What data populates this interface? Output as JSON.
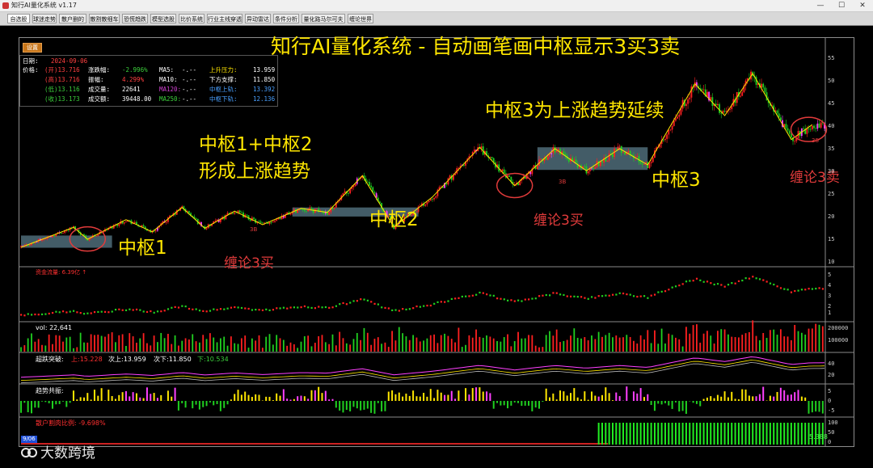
{
  "window": {
    "title": "知行AI量化系统 v1.17",
    "minimize": "—",
    "maximize": "☐",
    "close": "✕"
  },
  "tabs": [
    "自选股",
    "球迷走势",
    "散户删的",
    "散割散细车",
    "恐慌趋跌",
    "模型选股",
    "比价系统",
    "行业主线穿透",
    "异动雷达",
    "条件分析",
    "量化路马尔可夫",
    "缠论世界"
  ],
  "toolbar": {
    "settings_label": "设置"
  },
  "info": {
    "date_label": "日期:",
    "date_value": "2024-09-06",
    "price_label": "价格:",
    "open": "(开)13.716",
    "high": "(高)13.716",
    "low": "(低)13.116",
    "close": "(收)13.173",
    "chg_label": "涨跌幅:",
    "chg_value": "-2.996%",
    "amp_label": "振幅:",
    "amp_value": "4.299%",
    "vol_label": "成交量:",
    "vol_value": "22641",
    "amt_label": "成交额:",
    "amt_value": "39448.00",
    "ma5_label": "MA5:",
    "ma5_value": "-.--",
    "ma10_label": "MA10:",
    "ma10_value": "-.--",
    "ma120_label": "MA120:",
    "ma120_value": "-.--",
    "ma250_label": "MA250:",
    "ma250_value": "-.--",
    "up_label": "上升压力:",
    "up_value": "13.959",
    "down_label": "下方支撑:",
    "down_value": "11.850",
    "zu_label": "中枢上轨:",
    "zu_value": "13.392",
    "zd_label": "中枢下轨:",
    "zd_value": "12.136"
  },
  "annotations": {
    "title": "知行AI量化系统 - 自动画笔画中枢显示3买3卖",
    "z12_line1": "中枢1+中枢2",
    "z12_line2": "形成上涨趋势",
    "z3_trend": "中枢3为上涨趋势延续",
    "z1": "中枢1",
    "z2": "中枢2",
    "z3": "中枢3",
    "buy1": "缠论3买",
    "buy2": "缠论3买",
    "sell": "缠论3卖",
    "mark_3b1": "3B",
    "mark_3b2": "3B",
    "mark_3s": "3S"
  },
  "price_axis": [
    "55",
    "50",
    "45",
    "40",
    "35",
    "30",
    "25",
    "20",
    "15",
    "10"
  ],
  "indicators": {
    "fund_label": "资金流量: 6.39亿 ↑",
    "fund_axis": [
      "5",
      "4",
      "3",
      "2",
      "1"
    ],
    "vol_label": "vol: 22,641",
    "vol_axis": [
      "200000",
      "100000"
    ],
    "break_label": "超跌突破:",
    "break_up": "上:15.228",
    "break_mid": "次上:13.959",
    "break_down": "次下:11.850",
    "break_low": "下:10.534",
    "break_axis": [
      "40",
      "20"
    ],
    "trend_label": "趋势共振:",
    "trend_axis": [
      "5",
      "0",
      "-5"
    ],
    "retail_label": "散户割肉比例: -9.698%",
    "retail_axis": [
      "100",
      "50",
      "0"
    ],
    "retail_last": "5.388",
    "date_badge": "9/06"
  },
  "watermark": {
    "text": "大数跨境"
  },
  "colors": {
    "up": "#ff2020",
    "down": "#20d020",
    "highlight": "#ff40ff",
    "zone": "#5a7b8a",
    "annotation": "#ffe600",
    "mark": "#e23b3b",
    "pivot_line": "#ffe600"
  },
  "chart_data": {
    "type": "candlestick",
    "pivot_zones": [
      {
        "name": "中枢1",
        "from_bar": 0,
        "to_bar": 52,
        "low": 13.3,
        "high": 16.0
      },
      {
        "name": "中枢2",
        "from_bar": 155,
        "to_bar": 227,
        "low": 20.2,
        "high": 22.2
      },
      {
        "name": "中枢3",
        "from_bar": 295,
        "to_bar": 358,
        "low": 30.5,
        "high": 35.5
      }
    ],
    "zigzag": [
      [
        0,
        13.4
      ],
      [
        30,
        17.8
      ],
      [
        38,
        15.2
      ],
      [
        60,
        19.5
      ],
      [
        75,
        16.8
      ],
      [
        92,
        22.2
      ],
      [
        105,
        17.6
      ],
      [
        122,
        21.4
      ],
      [
        138,
        18.4
      ],
      [
        160,
        22.0
      ],
      [
        175,
        21.1
      ],
      [
        195,
        29.2
      ],
      [
        213,
        17.9
      ],
      [
        235,
        24.5
      ],
      [
        262,
        35.5
      ],
      [
        282,
        27.0
      ],
      [
        305,
        35.2
      ],
      [
        323,
        30.3
      ],
      [
        342,
        35.2
      ],
      [
        358,
        31.6
      ],
      [
        385,
        49.5
      ],
      [
        402,
        42.5
      ],
      [
        418,
        51.8
      ],
      [
        440,
        37.2
      ],
      [
        452,
        40.5
      ]
    ]
  }
}
